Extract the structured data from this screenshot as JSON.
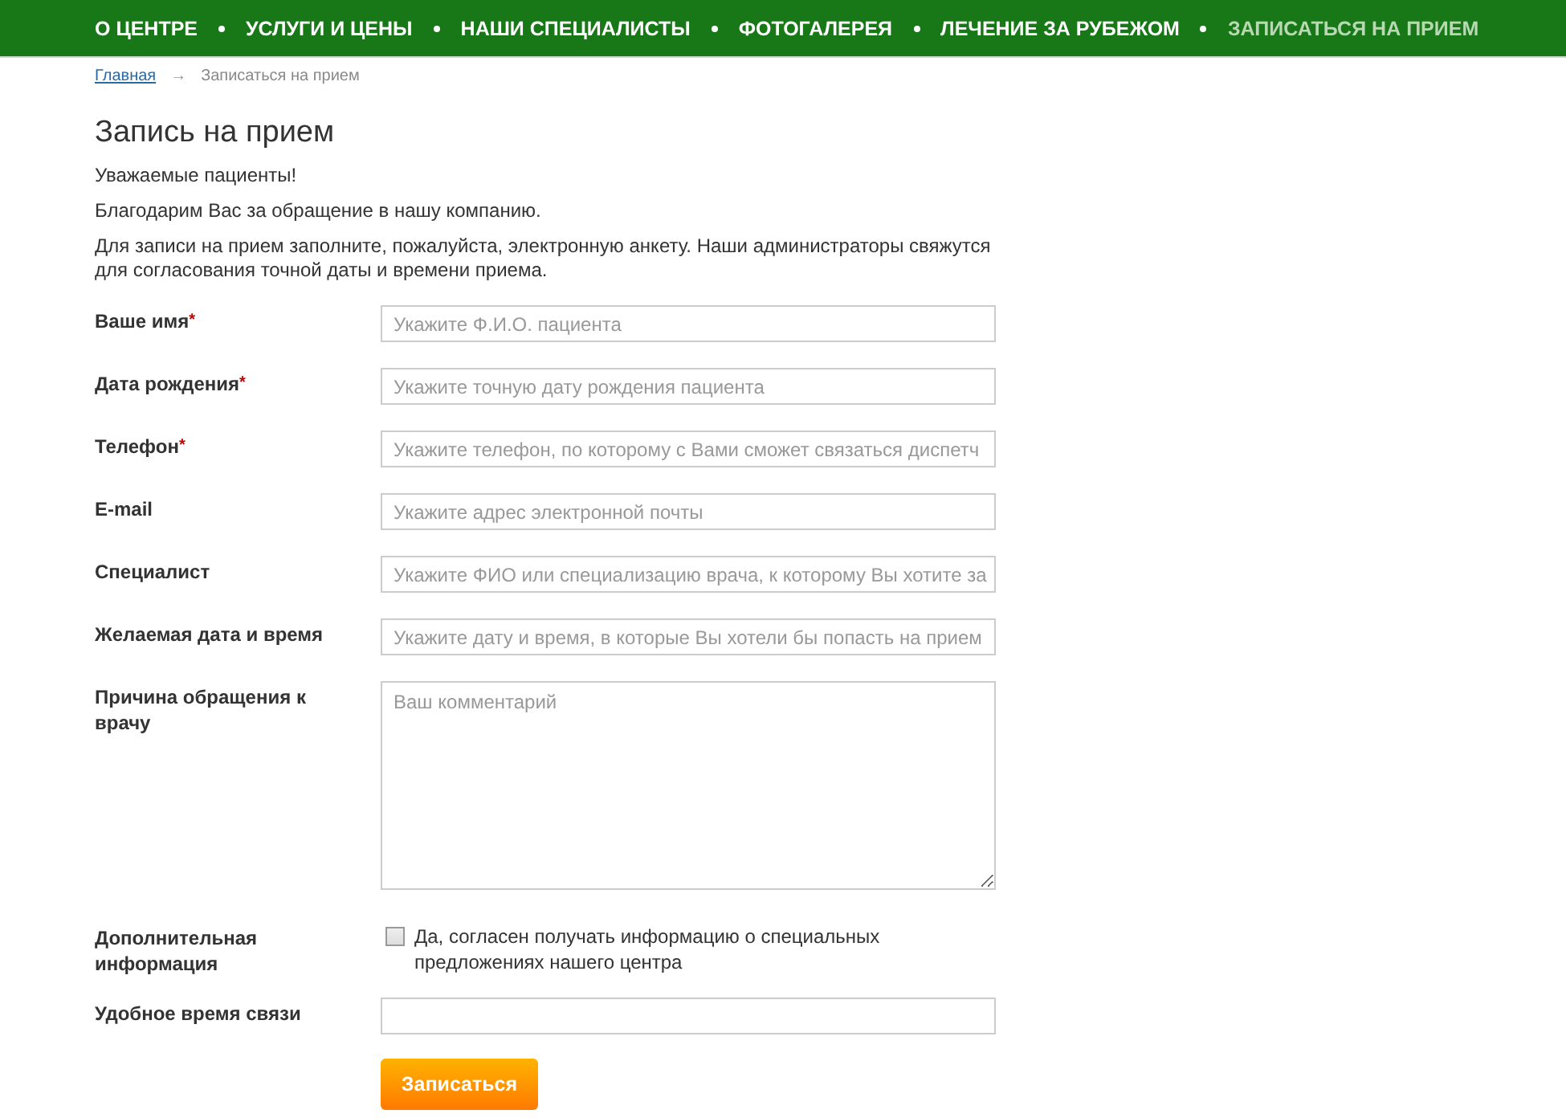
{
  "nav": [
    {
      "label": "О ЦЕНТРЕ",
      "selected": false
    },
    {
      "label": "УСЛУГИ И ЦЕНЫ",
      "selected": false
    },
    {
      "label": "НАШИ СПЕЦИАЛИСТЫ",
      "selected": false
    },
    {
      "label": "ФОТОГАЛЕРЕЯ",
      "selected": false
    },
    {
      "label": "ЛЕЧЕНИЕ ЗА РУБЕЖОМ",
      "selected": false
    },
    {
      "label": "ЗАПИСАТЬСЯ НА ПРИЕМ",
      "selected": true
    }
  ],
  "breadcrumb": {
    "link": "Главная",
    "separator": "→",
    "current": "Записаться на прием"
  },
  "title": "Запись на прием",
  "paragraphs": [
    "Уважаемые пациенты!",
    "Благодарим Вас за обращение в нашу компанию.",
    "Для записи на прием заполните, пожалуйста, электронную анкету. Наши администраторы свяжутся для согласования точной даты и времени приема."
  ],
  "fields": [
    {
      "kind": "text",
      "label": "Ваше имя",
      "mark": "*",
      "placeholder": "Укажите Ф.И.О. пациента"
    },
    {
      "kind": "text",
      "label": "Дата рождения",
      "mark": "*",
      "placeholder": "Укажите точную дату рождения пациента"
    },
    {
      "kind": "text",
      "label": "Телефон",
      "mark": "*",
      "placeholder": "Укажите телефон, по которому с Вами сможет связаться диспетч"
    },
    {
      "kind": "text",
      "label": "E-mail",
      "placeholder": "Укажите адрес электронной почты"
    },
    {
      "kind": "text",
      "label": "Специалист",
      "placeholder": "Укажите ФИО или специализацию врача, к которому Вы хотите за"
    },
    {
      "kind": "text",
      "label": "Желаемая дата и время",
      "placeholder": "Укажите дату и время, в которые Вы хотели бы попасть на прием"
    },
    {
      "kind": "textarea",
      "label": "Причина обращения к врачу",
      "placeholder": "Ваш комментарий"
    },
    {
      "kind": "checkbox",
      "label": "Дополнительная информация",
      "text": "Да, согласен получать информацию о специальных предложениях нашего центра",
      "checked": false
    },
    {
      "kind": "text",
      "label": "Удобное время связи"
    }
  ],
  "submit": "Записаться"
}
